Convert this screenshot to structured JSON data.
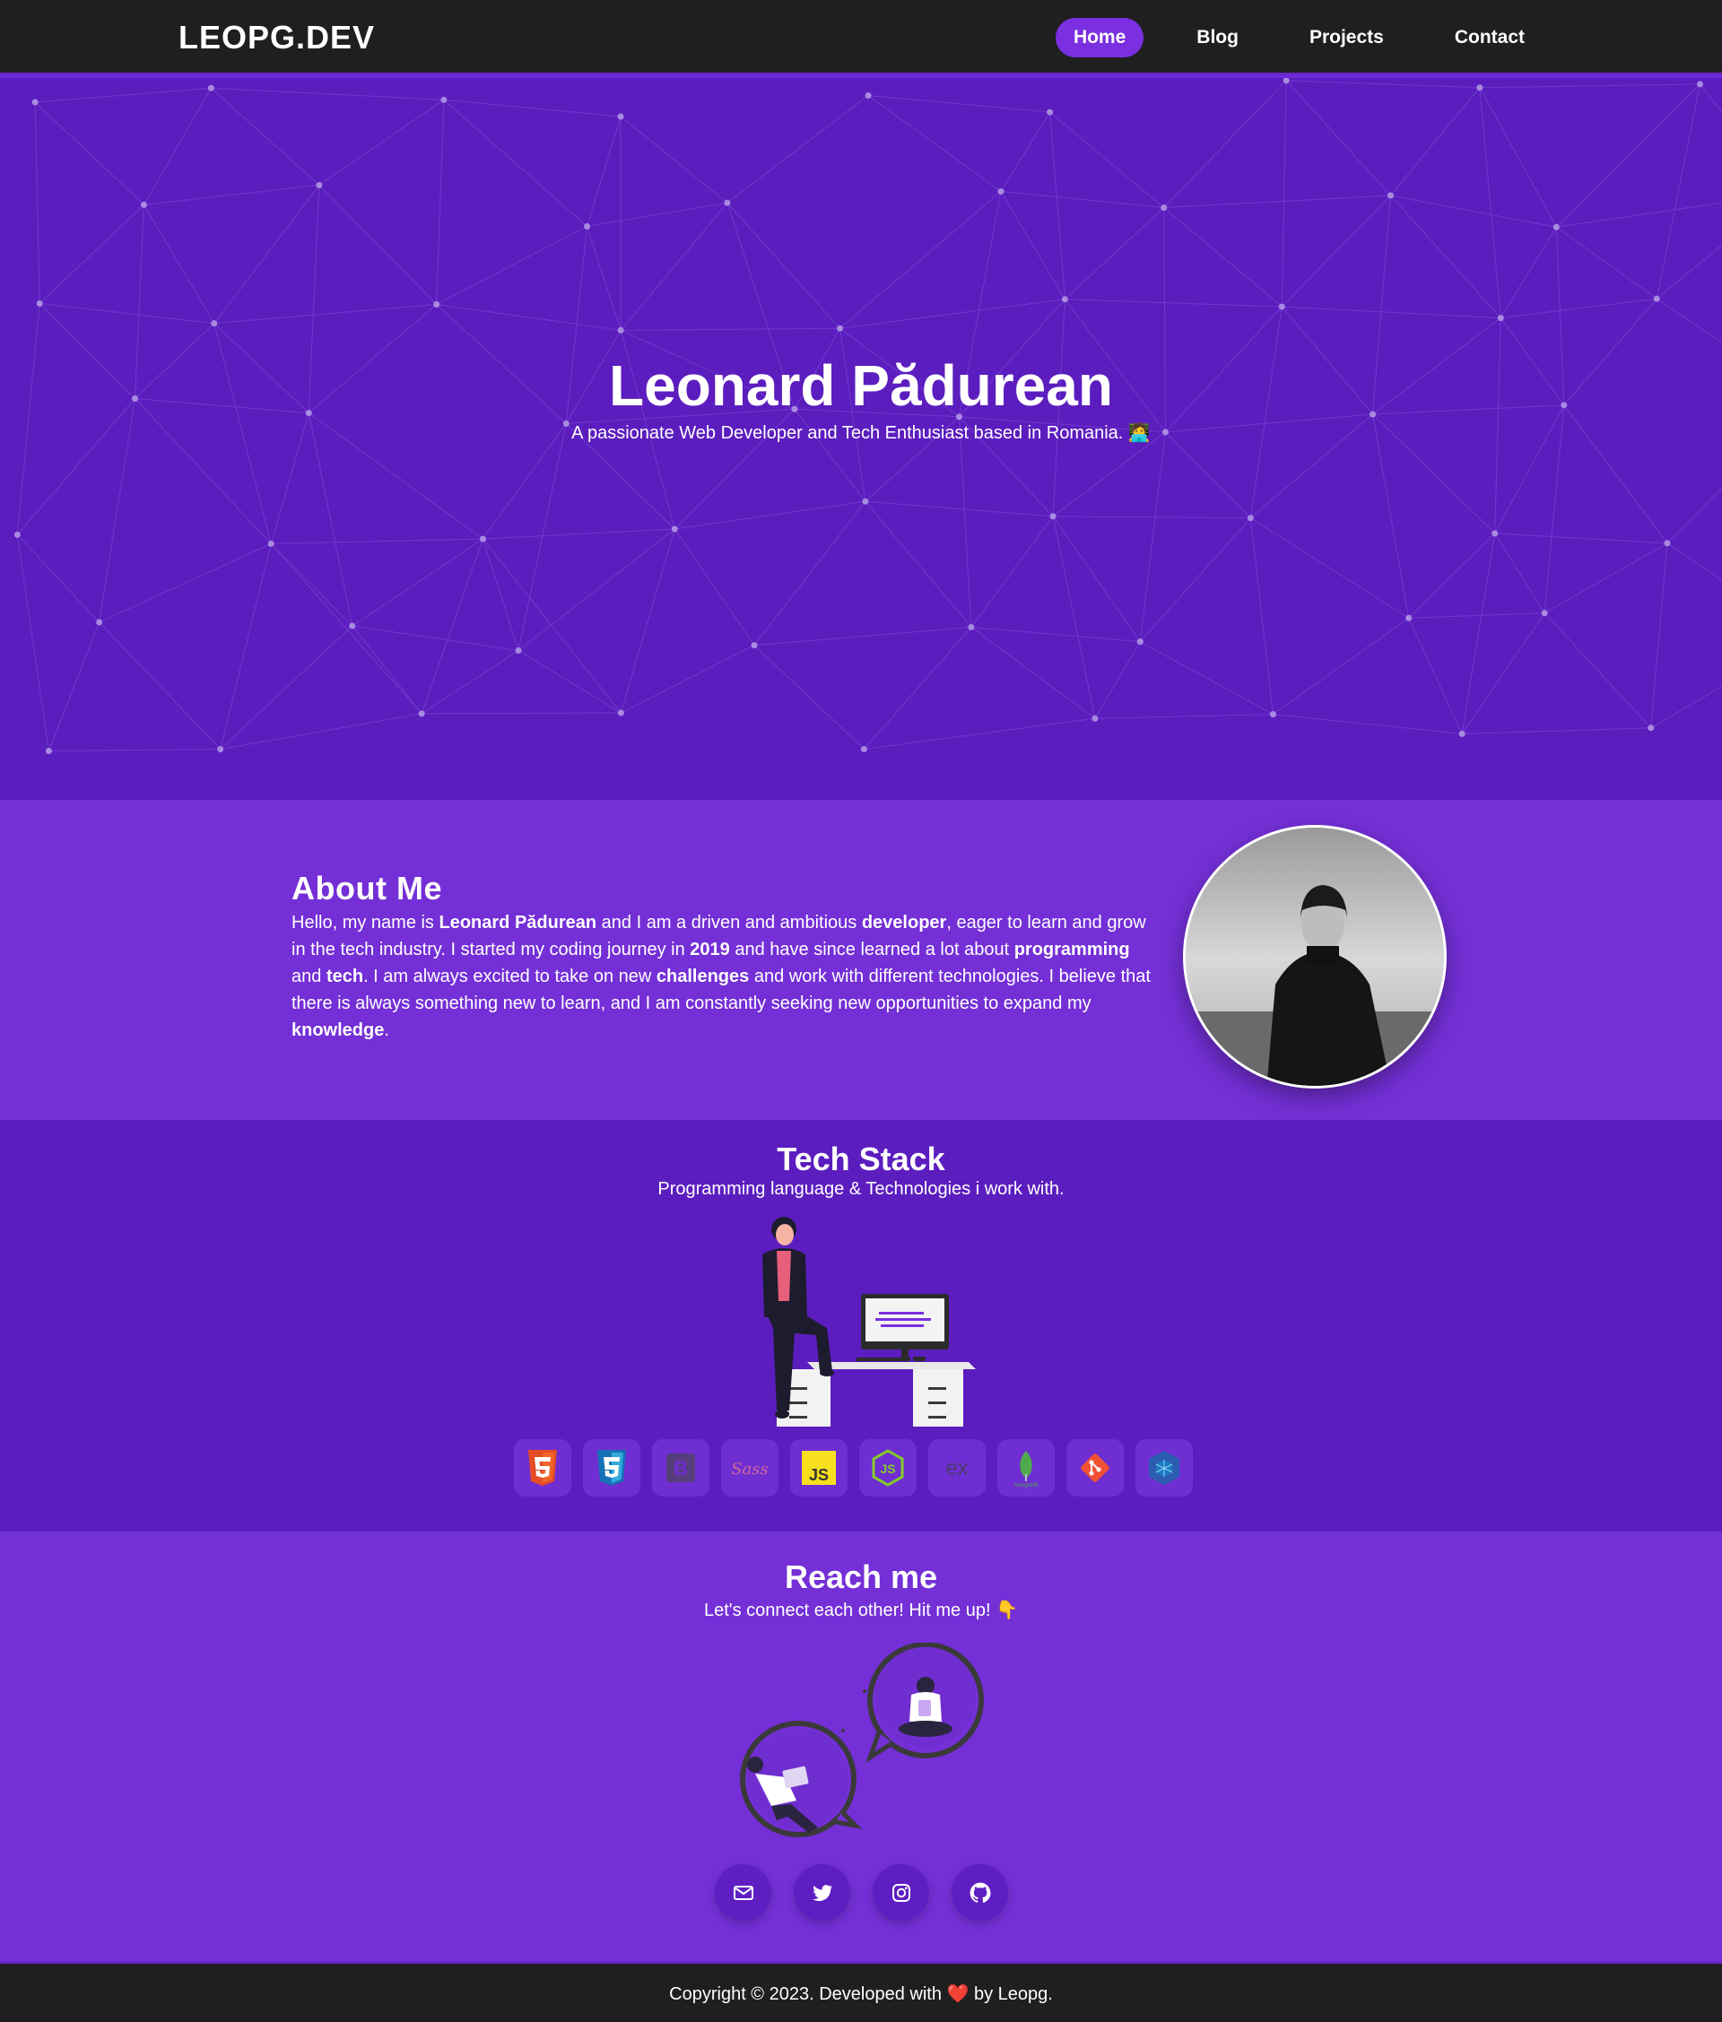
{
  "nav": {
    "brand": "LEOPG.DEV",
    "items": [
      {
        "label": "Home",
        "active": true
      },
      {
        "label": "Blog",
        "active": false
      },
      {
        "label": "Projects",
        "active": false
      },
      {
        "label": "Contact",
        "active": false
      }
    ]
  },
  "hero": {
    "title": "Leonard Pădurean",
    "subtitle": "A passionate Web Developer and Tech Enthusiast based in Romania. 🧑‍💻"
  },
  "about": {
    "title": "About Me",
    "segments": [
      {
        "text": "Hello, my name is ",
        "bold": false
      },
      {
        "text": "Leonard Pădurean",
        "bold": true
      },
      {
        "text": " and I am a driven and ambitious ",
        "bold": false
      },
      {
        "text": "developer",
        "bold": true
      },
      {
        "text": ", eager to learn and grow in the tech industry. I started my coding journey in ",
        "bold": false
      },
      {
        "text": "2019",
        "bold": true
      },
      {
        "text": " and have since learned a lot about ",
        "bold": false
      },
      {
        "text": "programming",
        "bold": true
      },
      {
        "text": " and ",
        "bold": false
      },
      {
        "text": "tech",
        "bold": true
      },
      {
        "text": ". I am always excited to take on new ",
        "bold": false
      },
      {
        "text": "challenges",
        "bold": true
      },
      {
        "text": " and work with different technologies. I believe that there is always something new to learn, and I am constantly seeking new opportunities to expand my ",
        "bold": false
      },
      {
        "text": "knowledge",
        "bold": true
      },
      {
        "text": ".",
        "bold": false
      }
    ]
  },
  "tech": {
    "title": "Tech Stack",
    "subtitle": "Programming language & Technologies i work with.",
    "icons": [
      "html5-icon",
      "css3-icon",
      "bootstrap-icon",
      "sass-icon",
      "javascript-icon",
      "nodejs-icon",
      "express-icon",
      "mongodb-icon",
      "git-icon",
      "webpack-icon"
    ],
    "icon_text": {
      "bootstrap": "B",
      "sass": "Sass",
      "js": "JS",
      "express": "ex",
      "mongodb": "mongoDB"
    }
  },
  "reach": {
    "title": "Reach me",
    "subtitle": "Let's connect each other! Hit me up! 👇",
    "socials": [
      "mail-icon",
      "twitter-icon",
      "instagram-icon",
      "github-icon"
    ]
  },
  "footer": {
    "before": "Copyright © 2023. Developed with ",
    "heart": "❤️",
    "after": " by Leopg."
  },
  "colors": {
    "navbar": "#1f1f1f",
    "accent": "#7a2fe0",
    "hero_bg": "#5c1dbf",
    "section_light": "#742fd6",
    "section_dark": "#5c1dbf"
  }
}
